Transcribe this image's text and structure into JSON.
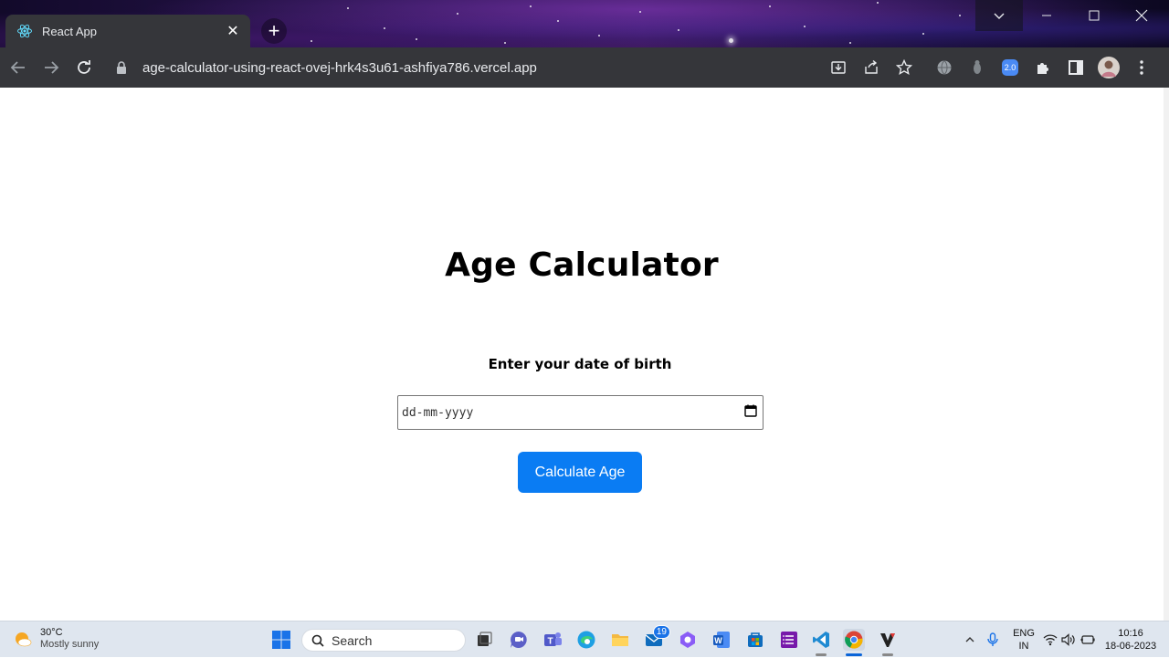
{
  "browser": {
    "tab_title": "React App",
    "url": "age-calculator-using-react-ovej-hrk4s3u61-ashfiya786.vercel.app",
    "extension_badge": "2.0"
  },
  "app": {
    "title": "Age Calculator",
    "dob_label": "Enter your date of birth",
    "date_placeholder": "dd-mm-yyyy",
    "calculate_button": "Calculate Age",
    "button_color": "#0a7cf3"
  },
  "taskbar": {
    "weather_temp": "30°C",
    "weather_desc": "Mostly sunny",
    "search_placeholder": "Search",
    "mail_badge": "19",
    "lang_line1": "ENG",
    "lang_line2": "IN",
    "time": "10:16",
    "date": "18-06-2023"
  }
}
